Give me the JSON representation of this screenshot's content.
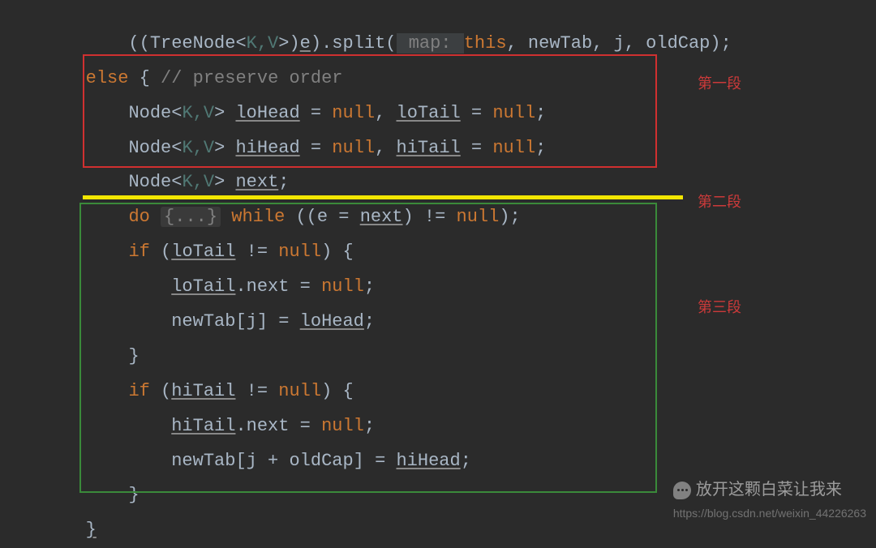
{
  "code": {
    "l1_a": "            ((TreeNode<",
    "l1_gen": "K,V",
    "l1_b": ">)",
    "l1_e": "e",
    "l1_c": ").split(",
    "l1_hint": " map: ",
    "l1_this": "this",
    "l1_d": ", newTab, j, oldCap);",
    "l2_else": "else",
    "l2_brace": " { ",
    "l2_comment": "// preserve order",
    "l3_a": "Node<",
    "l3_gen": "K,V",
    "l3_b": "> ",
    "l3_loHead": "loHead",
    "l3_eq1": " = ",
    "l3_null1": "null",
    "l3_c": ", ",
    "l3_loTail": "loTail",
    "l3_eq2": " = ",
    "l3_null2": "null",
    "l3_semi": ";",
    "l4_hiHead": "hiHead",
    "l4_hiTail": "hiTail",
    "l5_next": "next",
    "l6_do": "do",
    "l6_fold": "{...}",
    "l6_while": "while",
    "l6_expr_a": " ((e = ",
    "l6_expr_next": "next",
    "l6_expr_b": ") != ",
    "l6_null": "null",
    "l6_expr_c": ");",
    "l7_if": "if",
    "l7_a": " (",
    "l7_loTail": "loTail",
    "l7_b": " != ",
    "l7_null": "null",
    "l7_c": ") {",
    "l8_loTail": "loTail",
    "l8_a": ".next = ",
    "l8_null": "null",
    "l8_b": ";",
    "l9_a": "newTab[j] = ",
    "l9_loHead": "loHead",
    "l9_b": ";",
    "l10": "}",
    "l11_hiTail": "hiTail",
    "l12_hiTail": "hiTail",
    "l13_a": "newTab[j + oldCap] = ",
    "l13_hiHead": "hiHead",
    "l13_b": ";",
    "l14": "}",
    "l15": "}"
  },
  "labels": {
    "seg1": "第一段",
    "seg2": "第二段",
    "seg3": "第三段"
  },
  "watermark": {
    "title": "放开这颗白菜让我来",
    "sub": "https://blog.csdn.net/weixin_44226263"
  }
}
